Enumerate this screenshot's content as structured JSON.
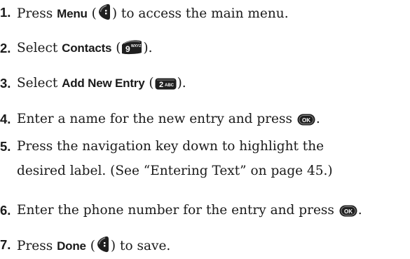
{
  "steps": [
    {
      "number": "1.",
      "pre": "Press ",
      "keyword": "Menu",
      "open": " (",
      "close": ") to access the main menu.",
      "icon": "left-softkey-icon"
    },
    {
      "number": "2.",
      "pre": "Select ",
      "keyword": "Contacts",
      "open": " (",
      "close": ").",
      "icon": "9-wxyz-key-icon",
      "icon_text": "9",
      "icon_sub": "WXYZ"
    },
    {
      "number": "3.",
      "pre": "Select ",
      "keyword": "Add New Entry",
      "open": " (",
      "close": ").",
      "icon": "2-abc-key-icon",
      "icon_text": "2",
      "icon_sub": "ABC"
    },
    {
      "number": "4.",
      "text": "Enter a name for the new entry and press ",
      "close": ".",
      "icon": "ok-key-icon",
      "icon_text": "OK"
    },
    {
      "number": "5.",
      "line1": "Press the navigation key down to highlight the",
      "line2": "desired label. (See “Entering Text” on page 45.)"
    },
    {
      "number": "6.",
      "text": "Enter the phone number for the entry and press ",
      "close": ".",
      "icon": "ok-key-icon",
      "icon_text": "OK"
    },
    {
      "number": "7.",
      "pre": "Press ",
      "keyword": "Done",
      "open": " (",
      "close": ") to save.",
      "icon": "left-softkey-icon"
    }
  ]
}
